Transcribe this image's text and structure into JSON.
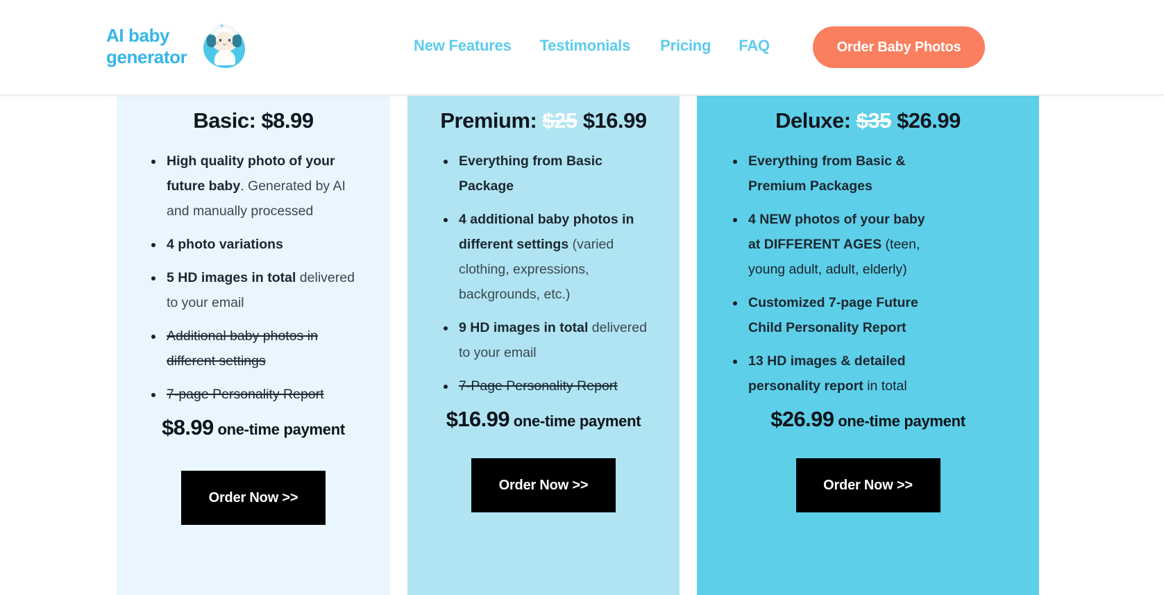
{
  "header": {
    "logo": {
      "line1": "AI baby",
      "line2": "generator",
      "icon": "baby-with-headphones-icon"
    },
    "nav": [
      {
        "label": "New Features"
      },
      {
        "label": "Testimonials"
      },
      {
        "label": "Pricing"
      },
      {
        "label": "FAQ"
      }
    ],
    "cta_label": "Order Baby Photos"
  },
  "pricing": {
    "plans": [
      {
        "id": "basic",
        "title_name": "Basic: ",
        "old_price": "",
        "price": "$8.99",
        "bg": "#e9f6fd",
        "features": [
          {
            "bold": "High quality photo of your future baby",
            "rest": ". Generated by AI and manually processed",
            "struck": false
          },
          {
            "bold": "4 photo variations",
            "rest": "",
            "struck": false
          },
          {
            "bold": "5 HD images in total",
            "rest": " delivered to your email",
            "struck": false
          },
          {
            "bold": "",
            "rest": "Additional baby photos in different settings",
            "struck": true
          },
          {
            "bold": "",
            "rest": "7-page Personality Report",
            "struck": true
          }
        ],
        "pay_amount": "$8.99",
        "pay_label": " one-time payment",
        "order_label": "Order Now >>"
      },
      {
        "id": "premium",
        "title_name": "Premium: ",
        "old_price": "$25",
        "price": "$16.99",
        "bg": "#b0e4f2",
        "features": [
          {
            "bold": "Everything from Basic Package",
            "rest": "",
            "struck": false
          },
          {
            "bold": "4 additional baby photos in different settings",
            "rest": " (varied clothing, expressions, backgrounds, etc.)",
            "struck": false
          },
          {
            "bold": "9 HD images in total",
            "rest": " delivered to your email",
            "struck": false
          },
          {
            "bold": "",
            "rest": "7-Page Personality Report",
            "struck": true
          }
        ],
        "pay_amount": "$16.99",
        "pay_label": " one-time payment",
        "order_label": "Order Now >>"
      },
      {
        "id": "deluxe",
        "title_name": "Deluxe: ",
        "old_price": "$35",
        "price": "$26.99",
        "bg": "#5ecfe8",
        "features": [
          {
            "bold": "Everything from Basic & Premium Packages",
            "rest": "",
            "struck": false
          },
          {
            "bold": "4 NEW photos of your baby at DIFFERENT AGES",
            "rest": " (teen, young adult, adult, elderly)",
            "struck": false
          },
          {
            "bold": "Customized 7-page Future Child Personality Report",
            "rest": "",
            "struck": false
          },
          {
            "bold": "13 HD images & detailed personality report",
            "rest": " in total",
            "struck": false
          }
        ],
        "pay_amount": "$26.99",
        "pay_label": " one-time payment",
        "order_label": "Order Now >>"
      }
    ]
  },
  "colors": {
    "brand_blue": "#35b6e6",
    "nav_blue": "#5ccbee",
    "cta_coral": "#fa7f5f",
    "button_black": "#000000",
    "basic_bg": "#e9f6fd",
    "premium_bg": "#b0e4f2",
    "deluxe_bg": "#5ecfe8"
  }
}
